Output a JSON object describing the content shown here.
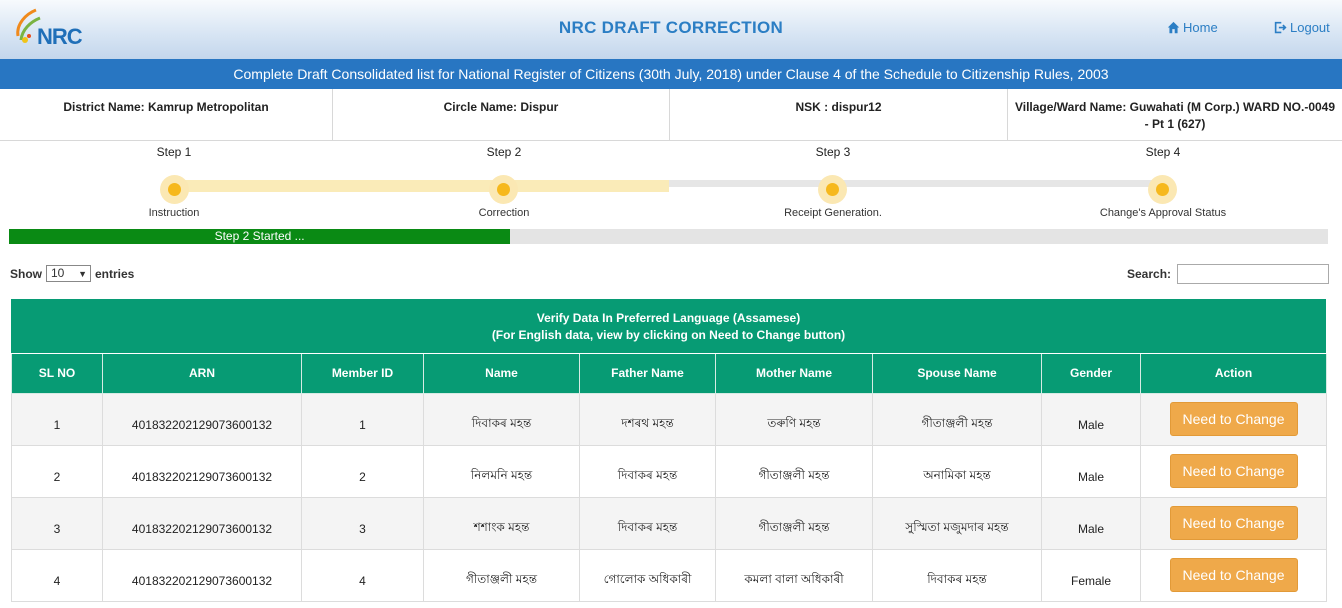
{
  "header": {
    "title": "NRC DRAFT CORRECTION",
    "logo_text": "NRC",
    "home_label": "Home",
    "logout_label": "Logout"
  },
  "banner": "Complete Draft Consolidated list for National Register of Citizens (30th July, 2018) under Clause 4 of the Schedule to Citizenship Rules, 2003",
  "info": {
    "district": "District Name: Kamrup Metropolitan",
    "circle": "Circle Name: Dispur",
    "nsk": "NSK : dispur12",
    "village_line1": "Village/Ward Name: Guwahati (M Corp.) WARD NO.-0049",
    "village_line2": "- Pt 1 (627)"
  },
  "stepper": {
    "steps": [
      {
        "label": "Step 1",
        "caption": "Instruction"
      },
      {
        "label": "Step 2",
        "caption": "Correction"
      },
      {
        "label": "Step 3",
        "caption": "Receipt Generation."
      },
      {
        "label": "Step 4",
        "caption": "Change's Approval Status"
      }
    ],
    "current_step": 2,
    "colors": {
      "done_track": "#faebb8",
      "dot": "#f6b81d"
    }
  },
  "progress": {
    "text": "Step 2 Started ...",
    "fraction": 0.38,
    "color": "#0a8a14"
  },
  "controls": {
    "show_label": "Show",
    "entries_value": "10",
    "entries_label": "entries",
    "search_label": "Search:",
    "search_value": ""
  },
  "table": {
    "caption_line1": "Verify Data In Preferred Language (Assamese)",
    "caption_line2": "(For English data, view by clicking on Need to Change button)",
    "header_color": "#079b74",
    "columns": [
      "SL NO",
      "ARN",
      "Member ID",
      "Name",
      "Father Name",
      "Mother Name",
      "Spouse Name",
      "Gender",
      "Action"
    ],
    "rows": [
      {
        "sl": "1",
        "arn": "401832202129073600132",
        "member_id": "1",
        "name": "দিবাকৰ মহন্ত",
        "father": "দশৰথ মহন্ত",
        "mother": "তৰুণি মহন্ত",
        "spouse": "গীতাঞ্জলী মহন্ত",
        "gender": "Male",
        "action": "Need to Change"
      },
      {
        "sl": "2",
        "arn": "401832202129073600132",
        "member_id": "2",
        "name": "নিলমনি মহন্ত",
        "father": "দিবাকৰ মহন্ত",
        "mother": "গীতাঞ্জলী মহন্ত",
        "spouse": "অনামিকা মহন্ত",
        "gender": "Male",
        "action": "Need to Change"
      },
      {
        "sl": "3",
        "arn": "401832202129073600132",
        "member_id": "3",
        "name": "শশাংক মহন্ত",
        "father": "দিবাকৰ মহন্ত",
        "mother": "গীতাঞ্জলী মহন্ত",
        "spouse": "সুস্মিতা মজুমদাৰ মহন্ত",
        "gender": "Male",
        "action": "Need to Change"
      },
      {
        "sl": "4",
        "arn": "401832202129073600132",
        "member_id": "4",
        "name": "গীতাঞ্জলী মহন্ত",
        "father": "গোলোক অধিকাৰী",
        "mother": "কমলা বালা অধিকাৰী",
        "spouse": "দিবাকৰ মহন্ত",
        "gender": "Female",
        "action": "Need to Change"
      }
    ]
  }
}
